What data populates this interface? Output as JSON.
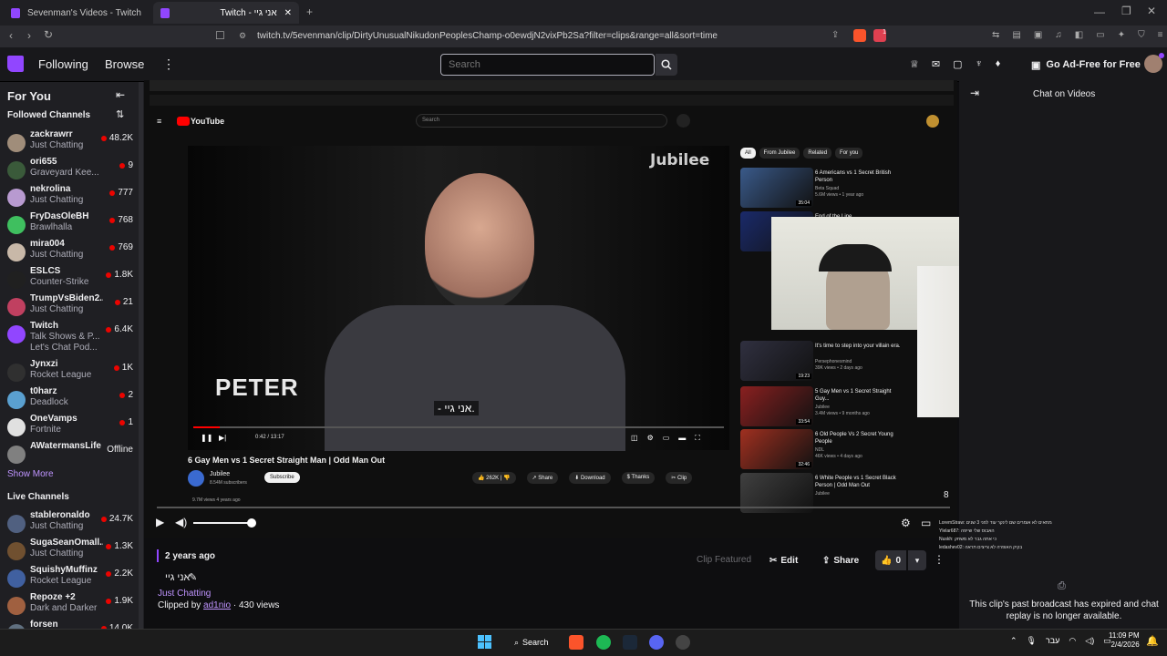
{
  "browser": {
    "tabs": [
      {
        "title": "Sevenman's Videos - Twitch",
        "active": false
      },
      {
        "title": "Twitch - אני גיי",
        "active": true
      }
    ],
    "url": "twitch.tv/5evenman/clip/DirtyUnusualNikudonPeoplesChamp-o0ewdjN2vixPb2Sa?filter=clips&range=all&sort=time",
    "badge_count": "1"
  },
  "twitch_nav": {
    "following": "Following",
    "browse": "Browse",
    "search_placeholder": "Search",
    "ad_free": "Go Ad-Free for Free"
  },
  "sidebar": {
    "for_you": "For You",
    "followed_header": "Followed Channels",
    "followed": [
      {
        "name": "zackrawrr",
        "game": "Just Chatting",
        "viewers": "48.2K",
        "color": "#a08d7a"
      },
      {
        "name": "ori655",
        "game": "Graveyard Kee...",
        "viewers": "9",
        "color": "#3a5a3a"
      },
      {
        "name": "nekrolina",
        "game": "Just Chatting",
        "viewers": "777",
        "color": "#b89ad0"
      },
      {
        "name": "FryDasOleBH",
        "game": "Brawlhalla",
        "viewers": "768",
        "color": "#3fbf5f"
      },
      {
        "name": "mira004",
        "game": "Just Chatting",
        "viewers": "769",
        "color": "#c8b8a8"
      },
      {
        "name": "ESLCS",
        "game": "Counter-Strike",
        "viewers": "1.8K",
        "color": "#202020"
      },
      {
        "name": "TrumpVsBiden2...",
        "game": "Just Chatting",
        "viewers": "21",
        "color": "#c04060"
      },
      {
        "name": "Twitch",
        "game": "Talk Shows & P...",
        "game2": "Let's Chat Pod...",
        "viewers": "6.4K",
        "color": "#9146ff"
      },
      {
        "name": "Jynxzi",
        "game": "Rocket League",
        "viewers": "1K",
        "color": "#303030"
      },
      {
        "name": "t0harz",
        "game": "Deadlock",
        "viewers": "2",
        "color": "#5aa0d0"
      },
      {
        "name": "OneVamps",
        "game": "Fortnite",
        "viewers": "1",
        "color": "#e0e0e0"
      },
      {
        "name": "AWatermansLife",
        "game": "",
        "viewers": "Offline",
        "color": "#808080"
      }
    ],
    "show_more": "Show More",
    "live_header": "Live Channels",
    "live": [
      {
        "name": "stableronaldo",
        "game": "Just Chatting",
        "viewers": "24.7K",
        "color": "#506080"
      },
      {
        "name": "SugaSeanOmall...",
        "game": "Just Chatting",
        "viewers": "1.3K",
        "color": "#705030"
      },
      {
        "name": "SquishyMuffinz",
        "game": "Rocket League",
        "viewers": "2.2K",
        "color": "#4060a0"
      },
      {
        "name": "Repoze +2",
        "game": "Dark and Darker",
        "viewers": "1.9K",
        "color": "#a06040"
      },
      {
        "name": "forsen",
        "game": "",
        "viewers": "14.0K",
        "color": "#607080"
      }
    ]
  },
  "youtube": {
    "search_placeholder": "Search",
    "logo": "YouTube",
    "watermark": "Jubilee",
    "name_overlay": "PETER",
    "subtitle": "- אני גיי.",
    "time": "0:42 / 13:17",
    "title": "6 Gay Men vs 1 Secret Straight Man | Odd Man Out",
    "channel": "Jubilee",
    "subscribers": "8.54M subscribers",
    "subscribe": "Subscribe",
    "likes": "262K",
    "share": "Share",
    "download": "Download",
    "thanks": "Thanks",
    "clip": "Clip",
    "views_line": "9.7M views  4 years ago",
    "chips": [
      "All",
      "From Jubilee",
      "Related",
      "For you"
    ],
    "recs": [
      {
        "title": "6 Americans vs 1 Secret British Person",
        "sub": "Beta Squad",
        "meta": "5.6M views • 1 year ago",
        "dur": "35:04",
        "color": "#3a5a8a"
      },
      {
        "title": "End of the Line",
        "sub": "",
        "meta": "",
        "dur": "",
        "color": "#1a2a6a"
      },
      {
        "title": "It's time to step into your villain era.",
        "sub": "Persephonesmind",
        "meta": "39K views • 2 days ago",
        "dur": "19:23",
        "color": "#303040"
      },
      {
        "title": "5 Gay Men vs 1 Secret Straight Guy...",
        "sub": "Jubilee",
        "meta": "3.4M views • 9 months ago",
        "dur": "33:54",
        "color": "#8a2020"
      },
      {
        "title": "6 Old People Vs 2 Secret Young People",
        "sub": "NDL",
        "meta": "46K views • 4 days ago",
        "dur": "32:46",
        "color": "#a03020"
      },
      {
        "title": "6 White People vs 1 Secret Black Person | Odd Man Out",
        "sub": "Jubilee",
        "meta": "",
        "dur": "",
        "color": "#404040"
      }
    ]
  },
  "clip": {
    "age": "2 years ago",
    "title": "אני גיי",
    "category": "Just Chatting",
    "clipped_by_label": "Clipped by",
    "clipper": "ad1nio",
    "views": "430 views",
    "featured": "Clip Featured",
    "edit": "Edit",
    "share": "Share",
    "likes": "0",
    "player_counter": "8"
  },
  "chat": {
    "title": "Chat on Videos",
    "expired": "This clip's past broadcast has expired and chat replay is no longer available.",
    "mini_lines": [
      "LoremStraw: מתאים לא אומרים שם לינקר עוד לפני 3 שנים",
      "Ylelar687: האבוס שלי שייפה",
      "Nuskh: כי אתה גבר לא משחק",
      "ledashev02: בקיק האופרה לא צייצים תראה"
    ]
  },
  "taskbar": {
    "search": "Search",
    "lang": "עבר",
    "time": "11:09 PM",
    "date": "2/4/2026"
  },
  "colors": {
    "twitch_purple": "#9146ff",
    "live_red": "#eb0400",
    "yt_red": "#ff0000"
  }
}
